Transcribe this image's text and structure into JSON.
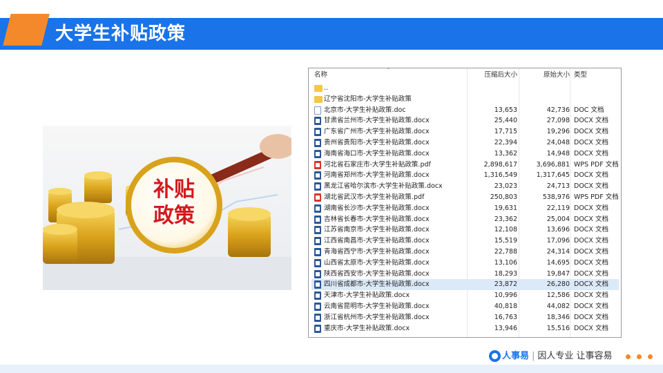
{
  "page": {
    "title": "大学生补贴政策"
  },
  "colors": {
    "header_blue": "#1a73e8",
    "accent_orange": "#f4892c"
  },
  "photo": {
    "caption_line1": "补贴",
    "caption_line2": "政策",
    "depicts": "gold-coins-and-magnifying-glass"
  },
  "explorer": {
    "columns": {
      "name": "名称",
      "compressed": "压缩后大小",
      "original": "原始大小",
      "type": "类型"
    },
    "rows": [
      {
        "icon": "folder-icon",
        "kind": "folder",
        "name": "..",
        "compressed": "",
        "original": "",
        "type": ""
      },
      {
        "icon": "folder-icon",
        "kind": "folder",
        "name": "辽宁省沈阳市-大学生补贴政策",
        "compressed": "",
        "original": "",
        "type": ""
      },
      {
        "icon": "doc-file-icon",
        "kind": "doc",
        "name": "北京市-大学生补贴政策.doc",
        "compressed": "13,653",
        "original": "42,736",
        "type": "DOC 文档"
      },
      {
        "icon": "docx-file-icon",
        "kind": "docx",
        "name": "甘肃省兰州市-大学生补贴政策.docx",
        "compressed": "25,440",
        "original": "27,098",
        "type": "DOCX 文档"
      },
      {
        "icon": "docx-file-icon",
        "kind": "docx",
        "name": "广东省广州市-大学生补贴政策.docx",
        "compressed": "17,715",
        "original": "19,296",
        "type": "DOCX 文档"
      },
      {
        "icon": "docx-file-icon",
        "kind": "docx",
        "name": "贵州省贵阳市-大学生补贴政策.docx",
        "compressed": "22,394",
        "original": "24,048",
        "type": "DOCX 文档"
      },
      {
        "icon": "docx-file-icon",
        "kind": "docx",
        "name": "海南省海口市-大学生补贴政策.docx",
        "compressed": "13,362",
        "original": "14,948",
        "type": "DOCX 文档"
      },
      {
        "icon": "pdf-file-icon",
        "kind": "pdf",
        "name": "河北省石家庄市-大学生补贴政策.pdf",
        "compressed": "2,898,617",
        "original": "3,696,881",
        "type": "WPS PDF 文档"
      },
      {
        "icon": "docx-file-icon",
        "kind": "docx",
        "name": "河南省郑州市-大学生补贴政策.docx",
        "compressed": "1,316,549",
        "original": "1,317,645",
        "type": "DOCX 文档"
      },
      {
        "icon": "docx-file-icon",
        "kind": "docx",
        "name": "黑龙江省哈尔滨市-大学生补贴政策.docx",
        "compressed": "23,023",
        "original": "24,713",
        "type": "DOCX 文档"
      },
      {
        "icon": "pdf-file-icon",
        "kind": "pdf",
        "name": "湖北省武汉市-大学生补贴政策.pdf",
        "compressed": "250,803",
        "original": "538,976",
        "type": "WPS PDF 文档"
      },
      {
        "icon": "docx-file-icon",
        "kind": "docx",
        "name": "湖南省长沙市-大学生补贴政策.docx",
        "compressed": "19,631",
        "original": "22,119",
        "type": "DOCX 文档"
      },
      {
        "icon": "docx-file-icon",
        "kind": "docx",
        "name": "吉林省长春市-大学生补贴政策.docx",
        "compressed": "23,362",
        "original": "25,004",
        "type": "DOCX 文档"
      },
      {
        "icon": "docx-file-icon",
        "kind": "docx",
        "name": "江苏省南京市-大学生补贴政策.docx",
        "compressed": "12,108",
        "original": "13,696",
        "type": "DOCX 文档"
      },
      {
        "icon": "docx-file-icon",
        "kind": "docx",
        "name": "江西省南昌市-大学生补贴政策.docx",
        "compressed": "15,519",
        "original": "17,096",
        "type": "DOCX 文档"
      },
      {
        "icon": "docx-file-icon",
        "kind": "docx",
        "name": "青海省西宁市-大学生补贴政策.docx",
        "compressed": "22,788",
        "original": "24,314",
        "type": "DOCX 文档"
      },
      {
        "icon": "docx-file-icon",
        "kind": "docx",
        "name": "山西省太原市-大学生补贴政策.docx",
        "compressed": "13,106",
        "original": "14,695",
        "type": "DOCX 文档"
      },
      {
        "icon": "docx-file-icon",
        "kind": "docx",
        "name": "陕西省西安市-大学生补贴政策.docx",
        "compressed": "18,293",
        "original": "19,847",
        "type": "DOCX 文档"
      },
      {
        "icon": "docx-file-icon",
        "kind": "docx",
        "name": "四川省成都市-大学生补贴政策.docx",
        "compressed": "23,872",
        "original": "26,280",
        "type": "DOCX 文档",
        "selected": true
      },
      {
        "icon": "docx-file-icon",
        "kind": "docx",
        "name": "天津市-大学生补贴政策.docx",
        "compressed": "10,996",
        "original": "12,586",
        "type": "DOCX 文档"
      },
      {
        "icon": "docx-file-icon",
        "kind": "docx",
        "name": "云南省昆明市-大学生补贴政策.docx",
        "compressed": "40,818",
        "original": "44,082",
        "type": "DOCX 文档"
      },
      {
        "icon": "docx-file-icon",
        "kind": "docx",
        "name": "浙江省杭州市-大学生补贴政策.docx",
        "compressed": "16,763",
        "original": "18,346",
        "type": "DOCX 文档"
      },
      {
        "icon": "docx-file-icon",
        "kind": "docx",
        "name": "重庆市-大学生补贴政策.docx",
        "compressed": "13,946",
        "original": "15,516",
        "type": "DOCX 文档"
      }
    ]
  },
  "footer": {
    "brand_name": "人事易",
    "separator": "|",
    "slogan": "因人专业 让事容易",
    "logo_icon": "renshiyi-logo-icon",
    "dots_icon": "more-dots-icon"
  }
}
